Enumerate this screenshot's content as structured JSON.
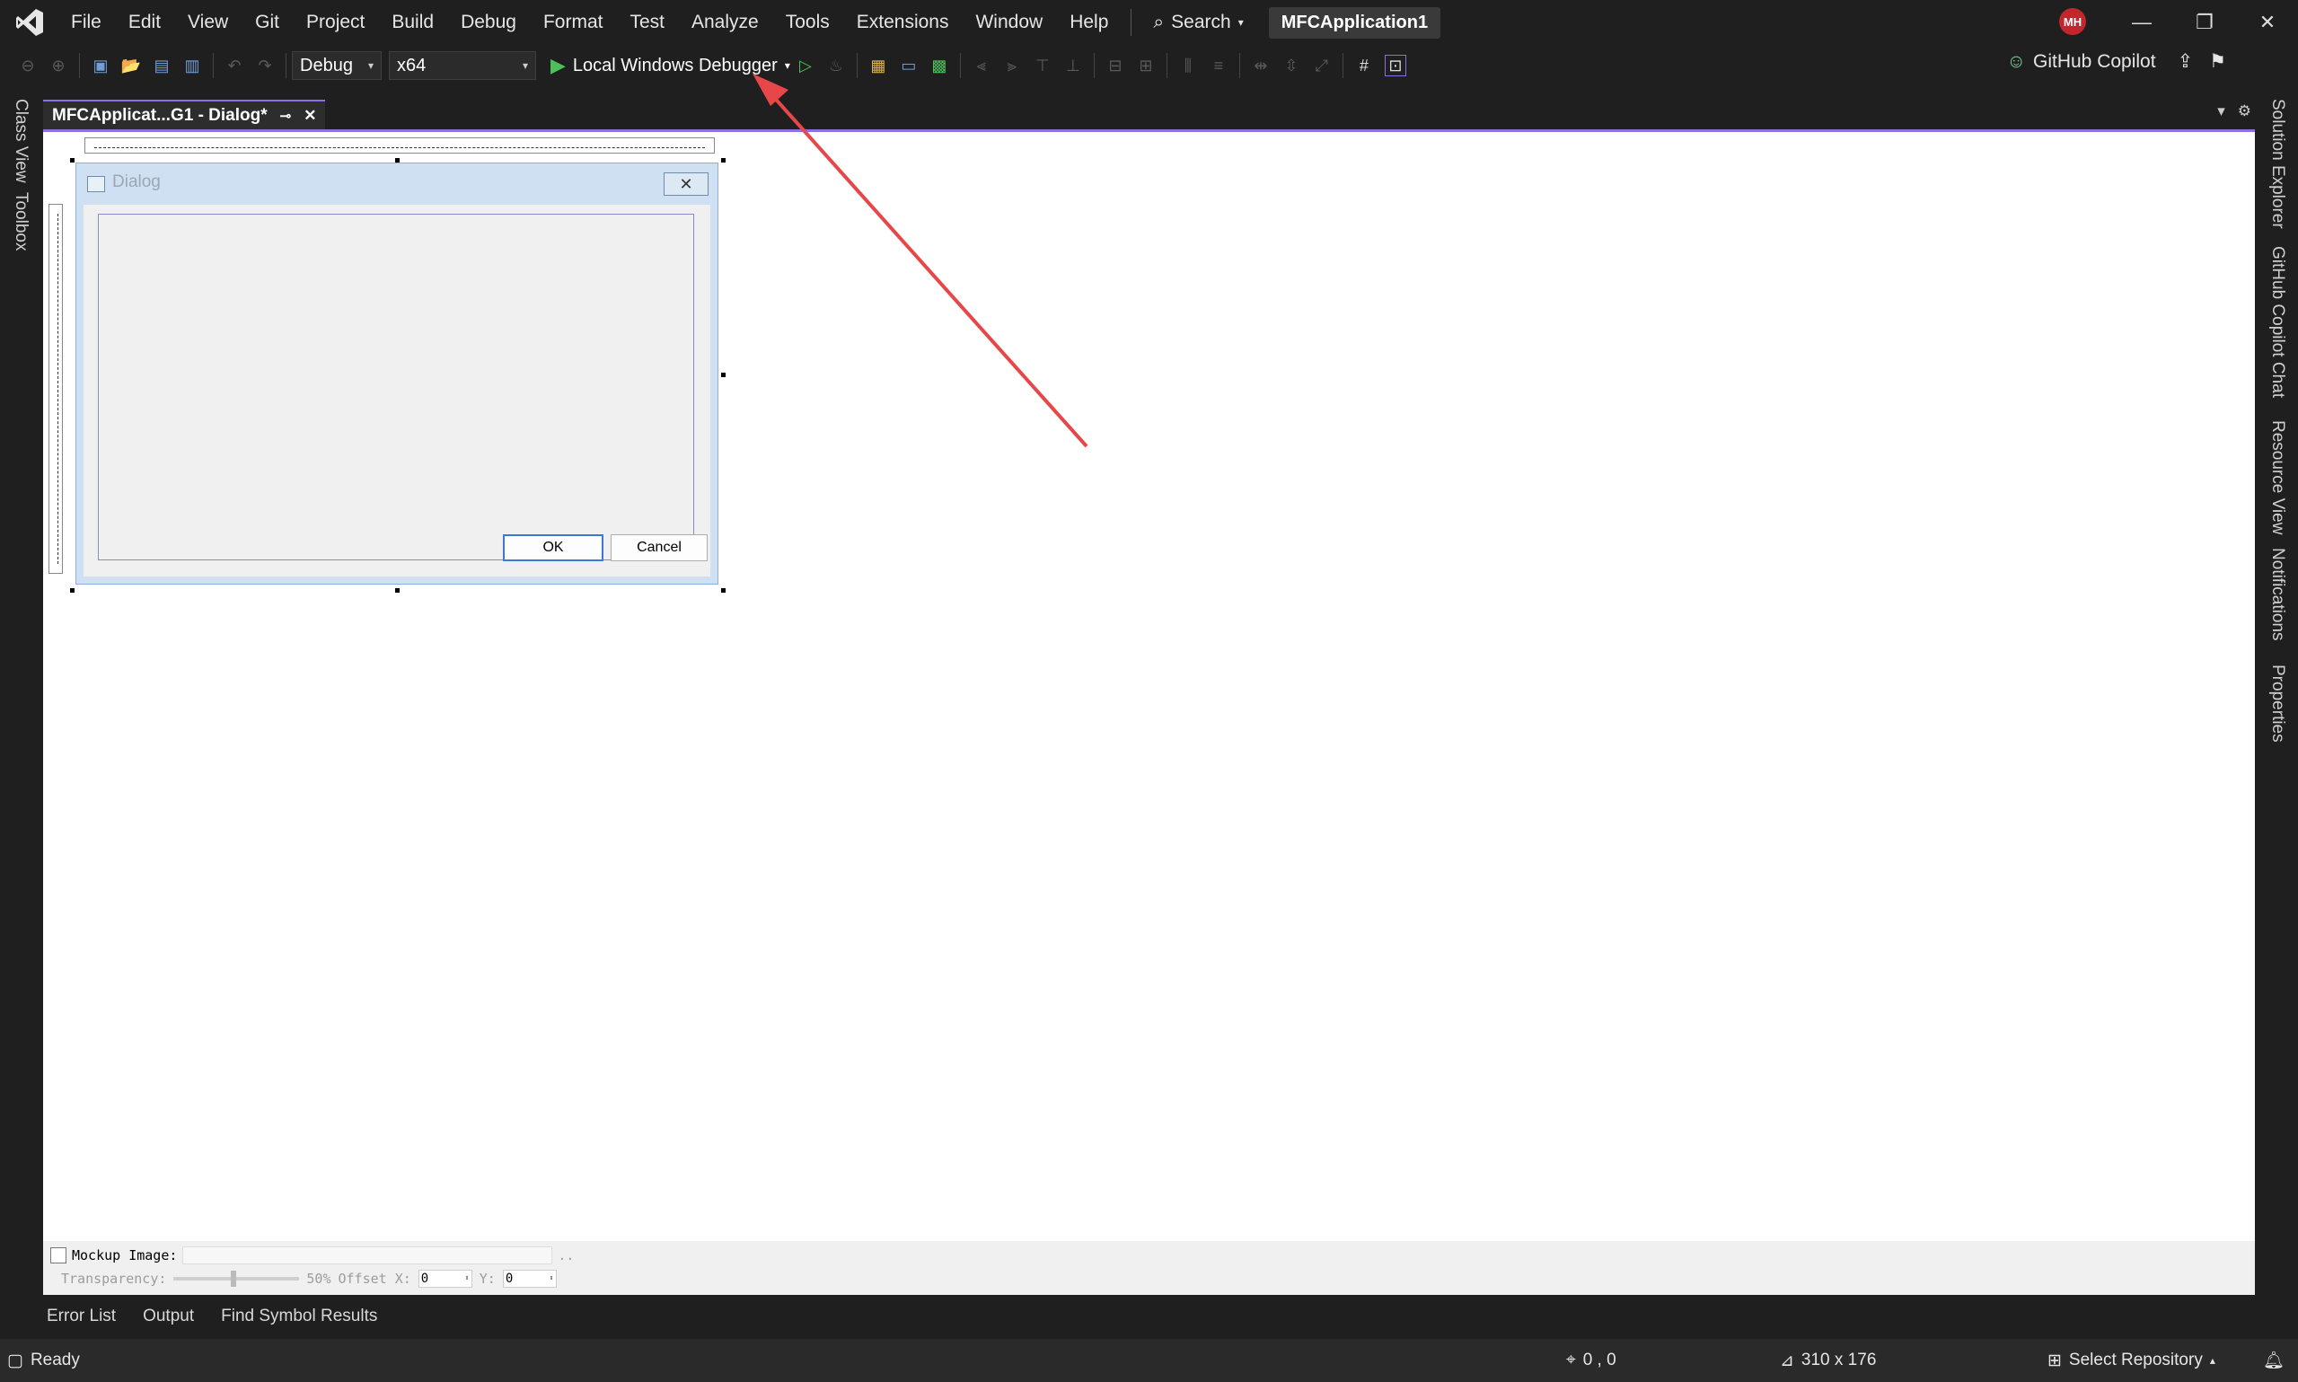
{
  "menubar": {
    "items": [
      "File",
      "Edit",
      "View",
      "Git",
      "Project",
      "Build",
      "Debug",
      "Format",
      "Test",
      "Analyze",
      "Tools",
      "Extensions",
      "Window",
      "Help"
    ],
    "search_label": "Search",
    "solution_name": "MFCApplication1",
    "avatar_initials": "MH"
  },
  "toolbar": {
    "configuration": "Debug",
    "platform": "x64",
    "run_label": "Local Windows Debugger",
    "copilot_label": "GitHub Copilot"
  },
  "left_rail": {
    "items": [
      "Class View",
      "Toolbox"
    ]
  },
  "right_rail": {
    "items": [
      "Solution Explorer",
      "GitHub Copilot Chat",
      "Resource View",
      "Notifications",
      "Properties"
    ]
  },
  "document_tab": {
    "title": "MFCApplicat...G1 - Dialog*"
  },
  "dialog": {
    "title": "Dialog",
    "ok_label": "OK",
    "cancel_label": "Cancel"
  },
  "mockup": {
    "image_label": "Mockup Image:",
    "transparency_label": "Transparency:",
    "transparency_value": "50%",
    "offset_x_label": "Offset X:",
    "offset_x_value": "0",
    "y_label": "Y:",
    "y_value": "0",
    "browse_label": ".."
  },
  "output_tabs": [
    "Error List",
    "Output",
    "Find Symbol Results"
  ],
  "status": {
    "ready": "Ready",
    "position": "0 , 0",
    "size": "310 x 176",
    "repository": "Select Repository"
  },
  "colors": {
    "accent": "#8c6fe0",
    "annotation_arrow": "#e8474a",
    "run_green": "#4cc15a"
  }
}
